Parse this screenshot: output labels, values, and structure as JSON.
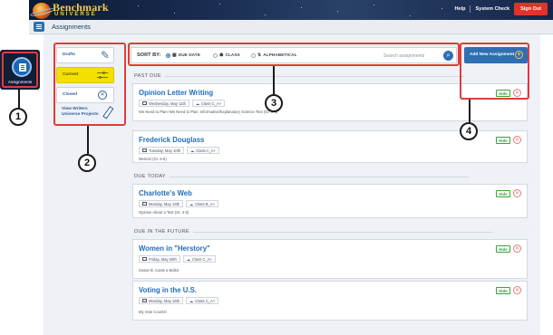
{
  "brand": {
    "name_top": "Benchmark",
    "name_bottom": "UNIVERSE"
  },
  "topbar": {
    "help": "Help",
    "system_check": "System Check",
    "sign_out": "Sign Out"
  },
  "subheader": {
    "title": "Assignments"
  },
  "sidebar": {
    "assignments_label": "Assignments"
  },
  "left_nav": {
    "drafts": "Drafts",
    "current": "Current",
    "closed": "Closed",
    "writers_line1": "View Writers",
    "writers_line2": "Universe Projects"
  },
  "sortbar": {
    "label": "SORT BY:",
    "options": [
      "DUE DATE",
      "CLASS",
      "ALPHABETICAL"
    ],
    "selected": "DUE DATE",
    "search_placeholder": "Search assignments"
  },
  "add_button": {
    "label": "Add New Assignment"
  },
  "sections": [
    {
      "label": "PAST DUE",
      "cards": [
        {
          "title": "Opinion Letter Writing",
          "date": "Wednesday, May 11th",
          "class": "Class C_A+",
          "desc": "We Need to Plan! We Need to Plan: Informative/Explanatory Science Text (Gr. 4-5)",
          "hide": "Hide"
        },
        {
          "title": "Frederick Douglass",
          "date": "Tuesday, May 10th",
          "class": "Class A_A+",
          "desc": "Memoir (Gr. 6-8)",
          "hide": "Hide"
        }
      ]
    },
    {
      "label": "DUE TODAY",
      "cards": [
        {
          "title": "Charlotte's Web",
          "date": "Monday, May 16th",
          "class": "Class B_A+",
          "desc": "Opinion About a Text (Gr. 4-5)",
          "hide": "Hide"
        }
      ]
    },
    {
      "label": "DUE IN THE FUTURE",
      "cards": [
        {
          "title": "Women in \"Herstory\"",
          "date": "Friday, May 20th",
          "class": "Class C_A+",
          "desc": "Susan B. Casts a Ballot",
          "hide": "Hide"
        },
        {
          "title": "Voting in the U.S.",
          "date": "Monday, May 16th",
          "class": "Class C_A+",
          "desc": "My Vote Counts!",
          "hide": "Hide"
        }
      ]
    }
  ],
  "annotations": [
    "1",
    "2",
    "3",
    "4"
  ],
  "colors": {
    "accent": "#2f6fb3",
    "current_tab": "#f3e000",
    "annotation": "#e23b3b",
    "title_link": "#1f6dbb"
  }
}
